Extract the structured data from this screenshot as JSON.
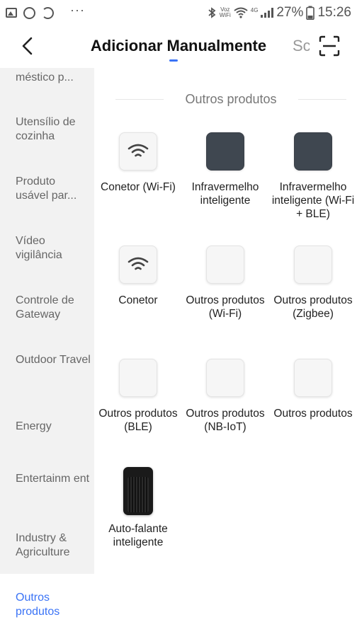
{
  "status_bar": {
    "dots": "···",
    "voz_label": "Voz",
    "wifi_label": "WiFi",
    "lte_label": "4G",
    "battery": "27%",
    "time": "15:26"
  },
  "header": {
    "title": "Adicionar Manualmente",
    "search_text": "Sc"
  },
  "sidebar": {
    "items": [
      {
        "label": "méstico p..."
      },
      {
        "label": "Utensílio de cozinha"
      },
      {
        "label": "Produto usável par..."
      },
      {
        "label": "Vídeo vigilância"
      },
      {
        "label": "Controle de Gateway"
      },
      {
        "label": "Outdoor Travel"
      },
      {
        "label": "Energy"
      },
      {
        "label": "Entertainm ent"
      },
      {
        "label": "Industry & Agriculture"
      },
      {
        "label": "Outros produtos"
      }
    ],
    "active_index": 9
  },
  "content": {
    "section_title": "Outros produtos",
    "products": [
      {
        "name": "Conetor (Wi-Fi)",
        "icon": "wifi-icon"
      },
      {
        "name": "Infravermelho inteligente",
        "icon": "ir-blaster"
      },
      {
        "name": "Infravermelho inteligente (Wi-Fi + BLE)",
        "icon": "ir-blaster"
      },
      {
        "name": "Conetor",
        "icon": "wifi-icon"
      },
      {
        "name": "Outros produtos (Wi-Fi)",
        "icon": "blank"
      },
      {
        "name": "Outros produtos (Zigbee)",
        "icon": "blank"
      },
      {
        "name": "Outros produtos (BLE)",
        "icon": "blank"
      },
      {
        "name": "Outros produtos (NB-IoT)",
        "icon": "blank"
      },
      {
        "name": "Outros produtos",
        "icon": "blank"
      },
      {
        "name": "Auto-falante inteligente",
        "icon": "speaker"
      }
    ]
  },
  "colors": {
    "accent": "#3a73f6",
    "sidebar_bg": "#f2f2f2",
    "ir_tile": "#3f4750"
  }
}
